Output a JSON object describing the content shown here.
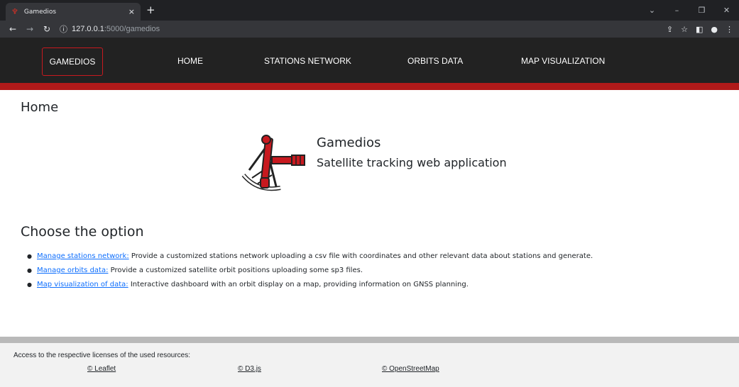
{
  "browser": {
    "tab_title": "Gamedios",
    "tab_close": "×",
    "new_tab": "+",
    "url_host": "127.0.0.1",
    "url_path": ":5000/gamedios",
    "info_icon": "ⓘ"
  },
  "sitenav": {
    "brand": "GAMEDIOS",
    "links": [
      "HOME",
      "STATIONS NETWORK",
      "ORBITS DATA",
      "MAP VISUALIZATION"
    ]
  },
  "page": {
    "title": "Home",
    "app_name": "Gamedios",
    "app_subtitle": "Satellite tracking web application",
    "choose_heading": "Choose the option",
    "options": [
      {
        "link": "Manage stations network:",
        "desc": " Provide a customized stations network uploading a csv file with coordinates and other relevant data about stations and generate."
      },
      {
        "link": "Manage orbits data:",
        "desc": " Provide a customized satellite orbit positions uploading some sp3 files."
      },
      {
        "link": "Map visualization of data:",
        "desc": " Interactive dashboard with an orbit display on a map, providing information on GNSS planning."
      }
    ]
  },
  "footer": {
    "note": "Access to the respective licenses of the used resources:",
    "licenses": [
      "© Leaflet",
      "© D3.js",
      "© OpenStreetMap"
    ]
  },
  "colors": {
    "accent_red": "#c8191f",
    "nav_bg": "#222222",
    "link_blue": "#0d6efd"
  }
}
